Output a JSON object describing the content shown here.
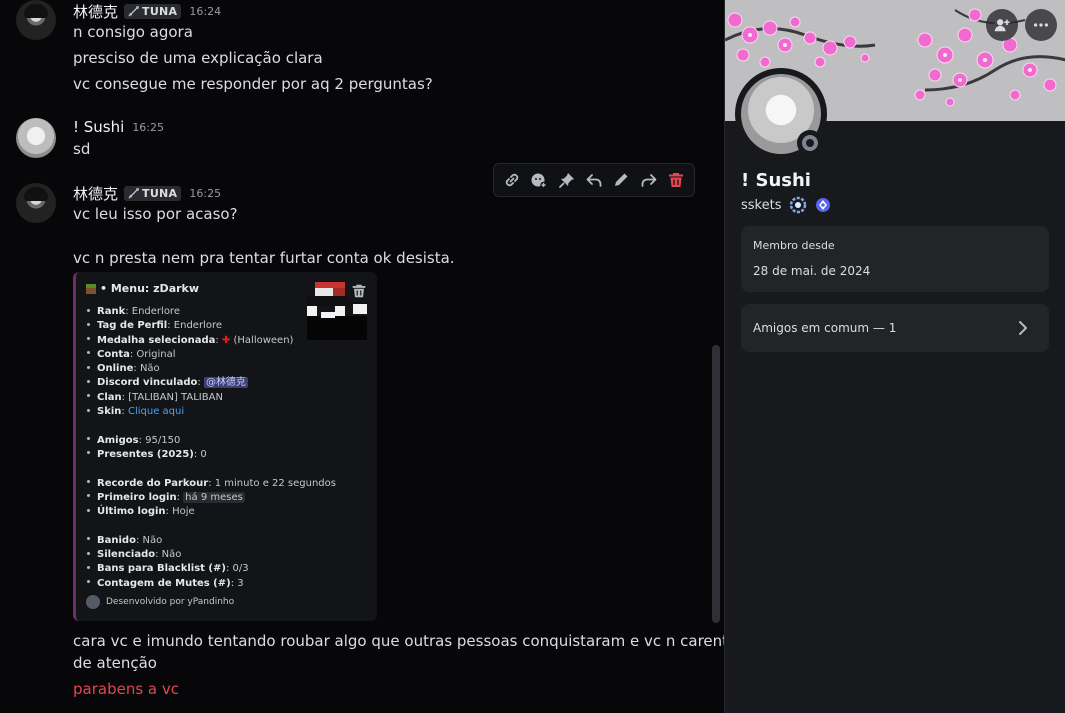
{
  "chat": {
    "messages": [
      {
        "author": "林德克",
        "tag": "TUNA",
        "time": "16:24",
        "lines": [
          "n consigo agora",
          "presciso de uma explicação clara",
          "vc consegue me responder por aq 2 perguntas?"
        ]
      },
      {
        "author": "! Sushi",
        "time": "16:25",
        "lines": [
          "sd"
        ]
      },
      {
        "author": "林德克",
        "tag": "TUNA",
        "time": "16:25",
        "lines": [
          "vc leu isso por acaso?",
          "vc n presta nem pra tentar furtar conta ok desista."
        ],
        "after_card": [
          "cara vc e imundo tentando roubar algo que outras pessoas conquistaram e vc n carente",
          "de atenção",
          "parabens a vc"
        ]
      }
    ],
    "toolbar_icons": [
      "link-icon",
      "add-reaction-icon",
      "pin-icon",
      "reply-icon",
      "edit-icon",
      "forward-icon",
      "delete-icon"
    ]
  },
  "card": {
    "title": "• Menu: zDarkw",
    "rows": [
      {
        "k": "Rank",
        "v": ": Enderlore"
      },
      {
        "k": "Tag de Perfil",
        "v": ": Enderlore"
      },
      {
        "k": "Medalha selecionada",
        "v": ": ",
        "medal": "✚",
        "v2": " (Halloween)"
      },
      {
        "k": "Conta",
        "v": ": Original"
      },
      {
        "k": "Online",
        "v": ": Não"
      },
      {
        "k": "Discord vinculado",
        "v": ": ",
        "mention": "@林德克"
      },
      {
        "k": "Clan",
        "v": ": [TALIBAN] TALIBAN"
      },
      {
        "k": "Skin",
        "v": ": ",
        "link": "Clique aqui"
      },
      {
        "gap": true
      },
      {
        "k": "Amigos",
        "v": ": 95/150"
      },
      {
        "k": "Presentes (2025)",
        "v": ": 0"
      },
      {
        "gap": true
      },
      {
        "k": "Recorde do Parkour",
        "v": ": 1 minuto e 22 segundos"
      },
      {
        "k": "Primeiro login",
        "v": ": ",
        "code": "há 9 meses"
      },
      {
        "k": "Último login",
        "v": ": Hoje"
      },
      {
        "gap": true
      },
      {
        "k": "Banido",
        "v": ": Não"
      },
      {
        "k": "Silenciado",
        "v": ": Não"
      },
      {
        "k": "Bans para Blacklist (#)",
        "v": ": 0/3"
      },
      {
        "k": "Contagem de Mutes (#)",
        "v": ": 3"
      }
    ],
    "footer": "Desenvolvido por yPandinho"
  },
  "profile": {
    "display_name": "! Sushi",
    "username": "sskets",
    "member_since_label": "Membro desde",
    "member_since": "28 de mai. de 2024",
    "mutual_friends": "Amigos em comum — 1",
    "colors": {
      "banner": "#bfbfc2",
      "blossom": "#f06ad0",
      "panel": "#18191d",
      "box": "#232428"
    }
  }
}
